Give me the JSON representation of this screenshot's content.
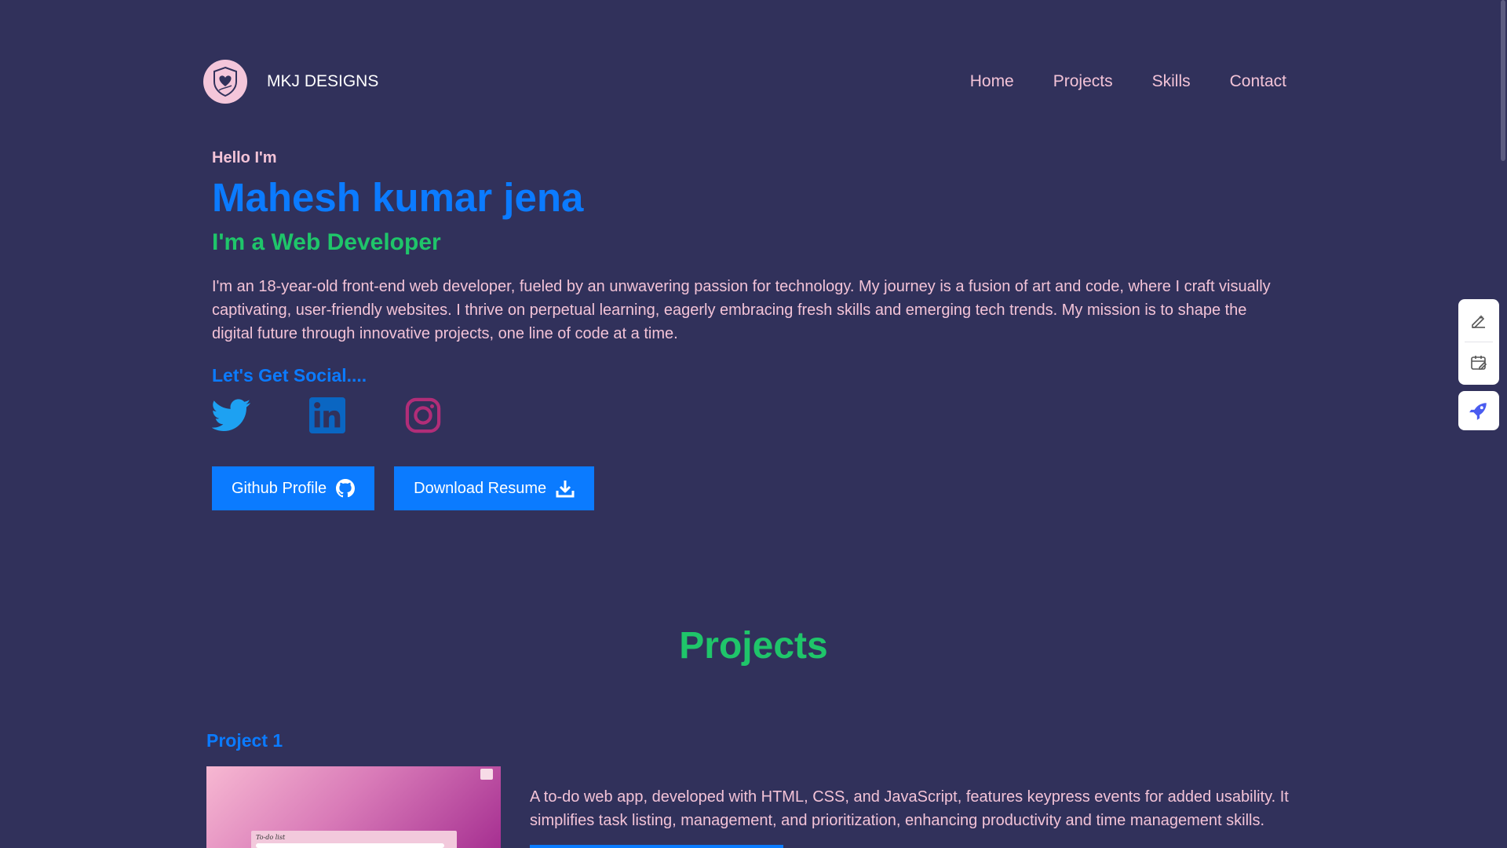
{
  "header": {
    "brand_name": "MKJ DESIGNS",
    "logo_icon": "heart-shield-icon",
    "nav": [
      {
        "label": "Home"
      },
      {
        "label": "Projects"
      },
      {
        "label": "Skills"
      },
      {
        "label": "Contact"
      }
    ]
  },
  "hero": {
    "greeting": "Hello I'm",
    "name": "Mahesh kumar jena",
    "role": "I'm a Web Developer",
    "bio": "I'm an 18-year-old front-end web developer, fueled by an unwavering passion for technology. My journey is a fusion of art and code, where I craft visually captivating, user-friendly websites. I thrive on perpetual learning, eagerly embracing fresh skills and emerging tech trends. My mission is to shape the digital future through innovative projects, one line of code at a time.",
    "social_heading": "Let's Get Social....",
    "social": [
      {
        "icon": "twitter-icon",
        "color": "#1da1f2"
      },
      {
        "icon": "linkedin-icon",
        "color": "#0a66c2"
      },
      {
        "icon": "instagram-icon",
        "color": "#b12d78"
      }
    ],
    "buttons": {
      "github": "Github Profile",
      "resume": "Download Resume"
    }
  },
  "projects": {
    "heading": "Projects",
    "items": [
      {
        "title": "Project 1",
        "thumbnail_text": "To-do list",
        "description": "A to-do web app, developed with HTML, CSS, and JavaScript, features keypress events for added usability. It simplifies task listing, management, and prioritization, enhancing productivity and time management skills."
      }
    ]
  },
  "side_widget": {
    "icons": [
      "edit-sparkle-icon",
      "calendar-edit-icon",
      "rocket-icon"
    ]
  },
  "colors": {
    "background": "#31315b",
    "accent_blue": "#0b7bff",
    "accent_green": "#1fc56a",
    "text_pink": "#f3c3d7"
  }
}
